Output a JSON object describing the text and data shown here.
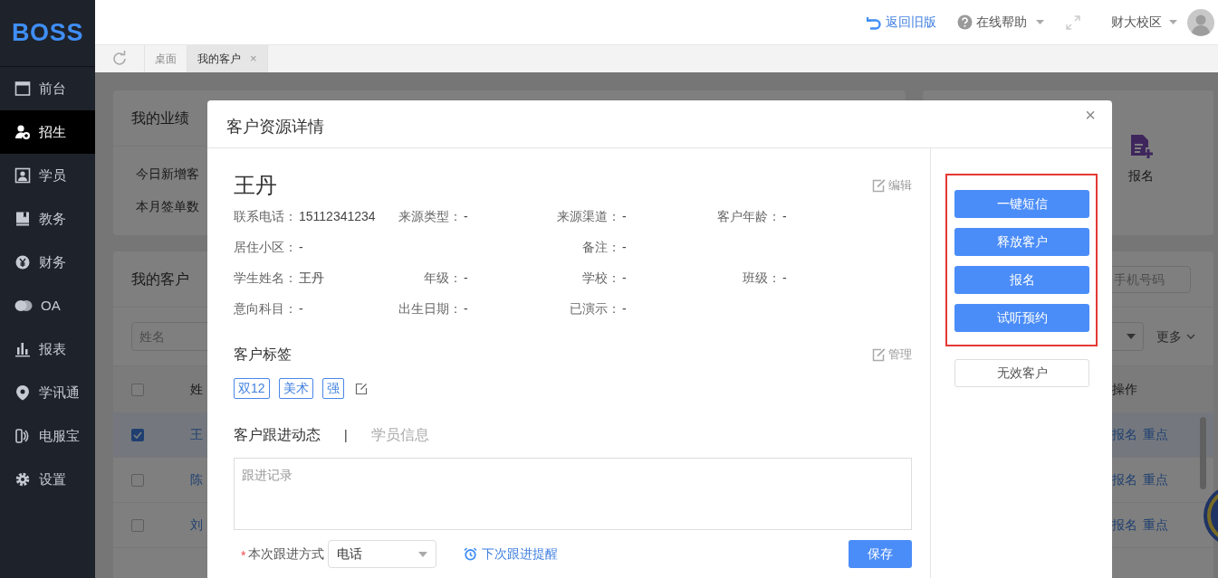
{
  "logo": "BOSS",
  "sidebar": {
    "items": [
      {
        "label": "前台",
        "selected": false
      },
      {
        "label": "招生",
        "selected": true
      },
      {
        "label": "学员",
        "selected": false
      },
      {
        "label": "教务",
        "selected": false
      },
      {
        "label": "财务",
        "selected": false
      },
      {
        "label": "OA",
        "selected": false
      },
      {
        "label": "报表",
        "selected": false
      },
      {
        "label": "学讯通",
        "selected": false
      },
      {
        "label": "电服宝",
        "selected": false
      },
      {
        "label": "设置",
        "selected": false
      }
    ]
  },
  "header": {
    "back_link": "返回旧版",
    "help": "在线帮助",
    "campus": "财大校区"
  },
  "tabs": [
    {
      "label": "桌面",
      "selected": false,
      "closable": false
    },
    {
      "label": "我的客户",
      "selected": true,
      "closable": true
    }
  ],
  "tab_close": "×",
  "background": {
    "performance": {
      "title": "我的业绩",
      "lines": [
        "今日新增客",
        "本月签单数"
      ]
    },
    "quick_action": "报名",
    "customers": {
      "title": "我的客户",
      "phone_placeholder": "手机号码",
      "name_placeholder": "姓名",
      "more": "更多",
      "columns": [
        "姓",
        "操作"
      ],
      "header_checked": false,
      "rows": [
        {
          "name": "王",
          "checked": true,
          "actions": [
            "报名",
            "重点"
          ]
        },
        {
          "name": "陈",
          "checked": false,
          "actions": [
            "报名",
            "重点"
          ]
        },
        {
          "name": "刘",
          "checked": false,
          "actions": [
            "报名",
            "重点"
          ]
        }
      ]
    }
  },
  "dialog": {
    "title": "客户资源详情",
    "close": "×",
    "customer_name": "王丹",
    "edit": "编辑",
    "info_rows": [
      [
        {
          "label": "联系电话：",
          "value": "15112341234",
          "wide": false
        },
        {
          "label": "来源类型：",
          "value": "-",
          "wide": false
        },
        {
          "label": "来源渠道：",
          "value": "-",
          "wide": false
        },
        {
          "label": "客户年龄：",
          "value": "-",
          "wide": false
        }
      ],
      [
        {
          "label": "居住小区：",
          "value": "-",
          "wide": true
        },
        {
          "label": "备注：",
          "value": "-",
          "wide": false
        }
      ],
      [
        {
          "label": "学生姓名：",
          "value": "王丹",
          "wide": false
        },
        {
          "label": "年级：",
          "value": "-",
          "wide": false
        },
        {
          "label": "学校：",
          "value": "-",
          "wide": false
        },
        {
          "label": "班级：",
          "value": "-",
          "wide": false
        }
      ],
      [
        {
          "label": "意向科目：",
          "value": "-",
          "wide": false
        },
        {
          "label": "出生日期：",
          "value": "-",
          "wide": false
        },
        {
          "label": "已演示：",
          "value": "-",
          "wide": false
        }
      ]
    ],
    "tags_title": "客户标签",
    "manage": "管理",
    "tags": [
      "双12",
      "美术",
      "强"
    ],
    "sections": [
      {
        "label": "客户跟进动态",
        "selected": true
      },
      {
        "label": "学员信息",
        "selected": false
      }
    ],
    "section_separator": "|",
    "record_placeholder": "跟进记录",
    "required_mark": "*",
    "method_label": "本次跟进方式",
    "method_value": "电话",
    "reminder": "下次跟进提醒",
    "save": "保存",
    "actions": [
      {
        "label": "一键短信",
        "kind": "primary"
      },
      {
        "label": "释放客户",
        "kind": "primary"
      },
      {
        "label": "报名",
        "kind": "primary"
      },
      {
        "label": "试听预约",
        "kind": "primary"
      },
      {
        "label": "无效客户",
        "kind": "plain"
      }
    ]
  }
}
